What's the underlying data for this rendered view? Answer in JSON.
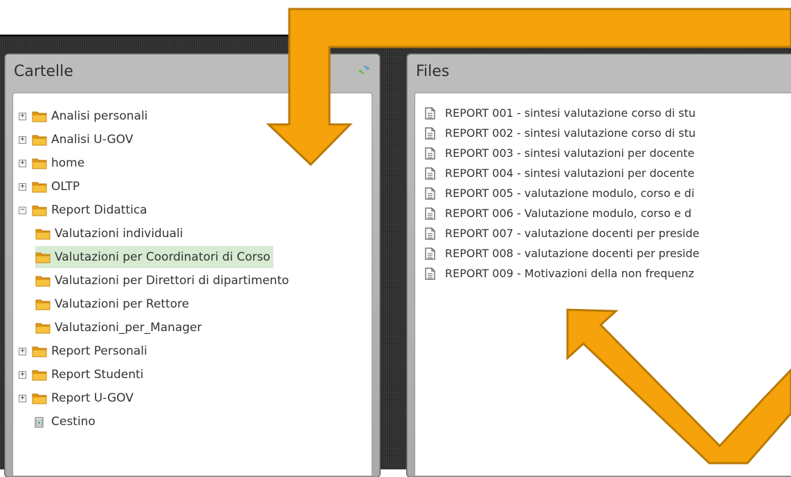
{
  "left_panel": {
    "title": "Cartelle",
    "refresh_icon": "refresh-icon",
    "tree": [
      {
        "label": "Analisi personali",
        "expander": "⊞",
        "level": 0
      },
      {
        "label": "Analisi U-GOV",
        "expander": "⊞",
        "level": 0
      },
      {
        "label": "home",
        "expander": "⊞",
        "level": 0
      },
      {
        "label": "OLTP",
        "expander": "⊞",
        "level": 0
      },
      {
        "label": "Report Didattica",
        "expander": "⊟",
        "level": 0
      },
      {
        "label": "Valutazioni individuali",
        "level": 1
      },
      {
        "label": "Valutazioni per Coordinatori di Corso",
        "level": 1,
        "selected": true
      },
      {
        "label": "Valutazioni per Direttori di dipartimento",
        "level": 1
      },
      {
        "label": "Valutazioni per Rettore",
        "level": 1
      },
      {
        "label": "Valutazioni_per_Manager",
        "level": 1
      },
      {
        "label": "Report Personali",
        "expander": "⊞",
        "level": 0
      },
      {
        "label": "Report Studenti",
        "expander": "⊞",
        "level": 0
      },
      {
        "label": "Report U-GOV",
        "expander": "⊞",
        "level": 0
      },
      {
        "label": "Cestino",
        "level": 0,
        "icon": "trash-icon"
      }
    ]
  },
  "right_panel": {
    "title": "Files",
    "files": [
      "REPORT 001 - sintesi valutazione corso di stu",
      "REPORT 002 - sintesi valutazione corso di stu",
      "REPORT 003 - sintesi valutazioni per docente",
      "REPORT 004 - sintesi valutazioni per docente",
      "REPORT 005 - valutazione modulo, corso e di",
      "REPORT 006 - Valutazione modulo, corso e d",
      "REPORT 007 - valutazione docenti per preside",
      "REPORT 008 - valutazione docenti per preside",
      "REPORT 009 - Motivazioni della non frequenz"
    ]
  },
  "colors": {
    "arrow_fill": "#f5a20b",
    "arrow_stroke": "#b87908",
    "selected_bg": "#d6ebd2",
    "folder": "#f2b531"
  }
}
